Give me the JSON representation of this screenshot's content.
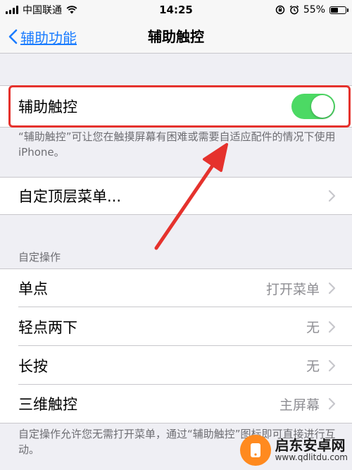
{
  "status_bar": {
    "carrier": "中国联通",
    "time": "14:25",
    "battery": "55%",
    "battery_level": 0.55,
    "icons": [
      "signal-icon",
      "wifi-icon",
      "rotation-lock-icon",
      "alarm-icon",
      "battery-icon"
    ]
  },
  "nav": {
    "back_label": "辅助功能",
    "title": "辅助触控"
  },
  "assistive_touch": {
    "label": "辅助触控",
    "enabled": true,
    "footnote": "“辅助触控”可让您在触摸屏幕有困难或需要自适应配件的情况下使用 iPhone。"
  },
  "top_menu": {
    "label": "自定顶层菜单..."
  },
  "custom_actions": {
    "header": "自定操作",
    "items": [
      {
        "label": "单点",
        "value": "打开菜单"
      },
      {
        "label": "轻点两下",
        "value": "无"
      },
      {
        "label": "长按",
        "value": "无"
      },
      {
        "label": "三维触控",
        "value": "主屏幕"
      }
    ],
    "footnote": "自定操作允许您无需打开菜单，通过“辅助触控”图标即可直接进行互动。"
  },
  "watermark": {
    "name": "启东安卓网",
    "url": "www.qdlitdu.com"
  },
  "colors": {
    "accent": "#1a7cff",
    "toggle_on": "#4cd964",
    "annotation": "#e5322d",
    "watermark": "#ff8a1f"
  }
}
